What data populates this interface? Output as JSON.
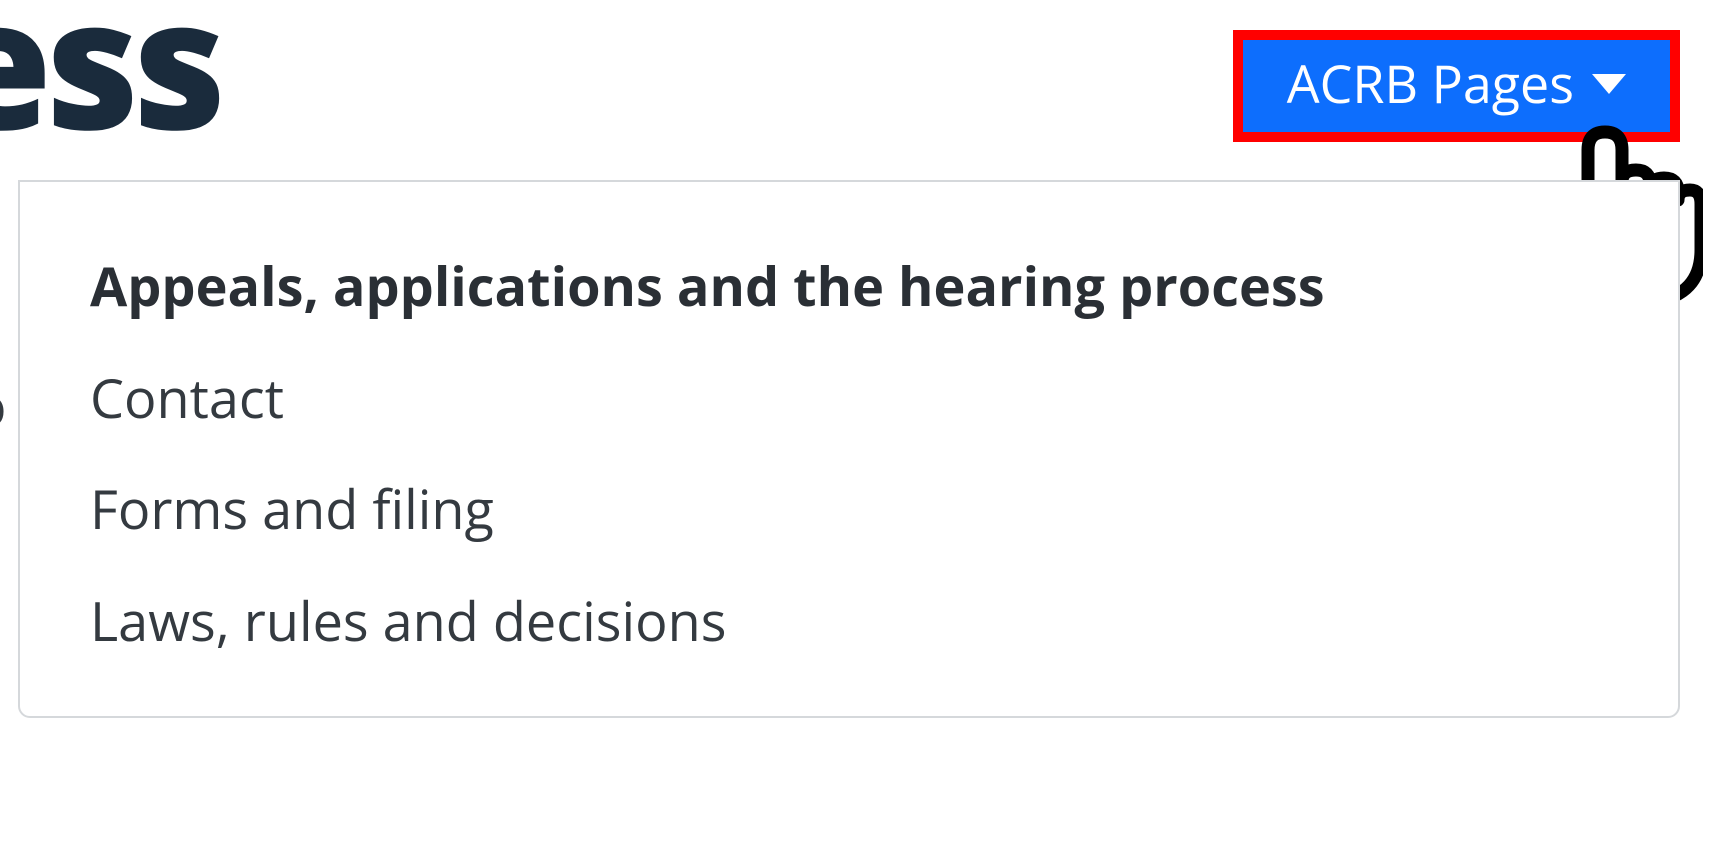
{
  "page": {
    "title_fragment": "Process"
  },
  "dropdown": {
    "button_label": "ACRB Pages",
    "menu_items": [
      {
        "label": "Appeals, applications and the hearing process",
        "active": true
      },
      {
        "label": "Contact",
        "active": false
      },
      {
        "label": "Forms and filing",
        "active": false
      },
      {
        "label": "Laws, rules and decisions",
        "active": false
      }
    ]
  },
  "annotations": {
    "highlight_color": "#ff0000",
    "button_bg": "#0d6efd",
    "cursor": "hand-pointer"
  },
  "left_sliver_char": "o"
}
